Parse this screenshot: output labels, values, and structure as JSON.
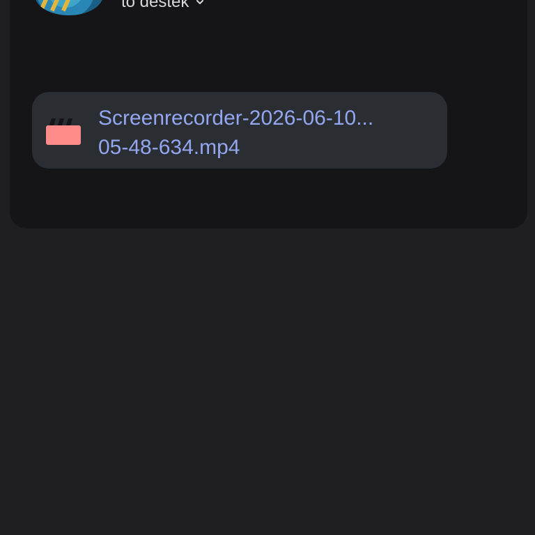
{
  "message": {
    "recipient_label": "to destek",
    "avatar_icon": "avatar-image"
  },
  "attachment": {
    "icon": "clapperboard-icon",
    "name_line_1": "Screenrecorder-2026-06-10...",
    "name_line_2": "05-48-634.mp4",
    "icon_color": "#ff8b8b",
    "text_color": "#93a7f0"
  },
  "colors": {
    "background": "#1f1f22",
    "card": "#151518",
    "attachment_chip": "#2a2d31"
  }
}
